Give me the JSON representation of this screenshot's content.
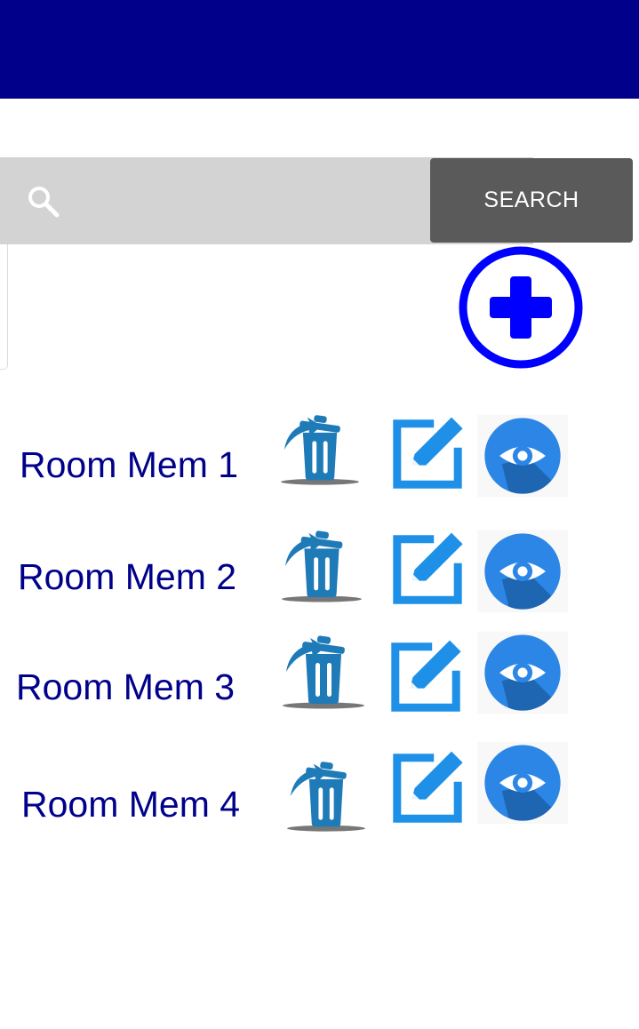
{
  "search": {
    "placeholder": "",
    "button_label": "SEARCH"
  },
  "colors": {
    "app_bar": "#00008b",
    "search_bar": "#d3d3d3",
    "search_button": "#5a5a5a",
    "add_button": "#0000ff",
    "row_text": "#00008b",
    "delete_icon": "#1f7bb8",
    "edit_icon": "#1e90e8",
    "view_icon": "#2c86e6"
  },
  "icons": {
    "search": "search-icon",
    "add": "plus-circle-icon",
    "delete": "trash-icon",
    "edit": "edit-icon",
    "view": "eye-icon"
  },
  "rooms": [
    {
      "label": "Room Mem 1"
    },
    {
      "label": "Room Mem 2"
    },
    {
      "label": "Room Mem 3"
    },
    {
      "label": "Room Mem 4"
    }
  ]
}
